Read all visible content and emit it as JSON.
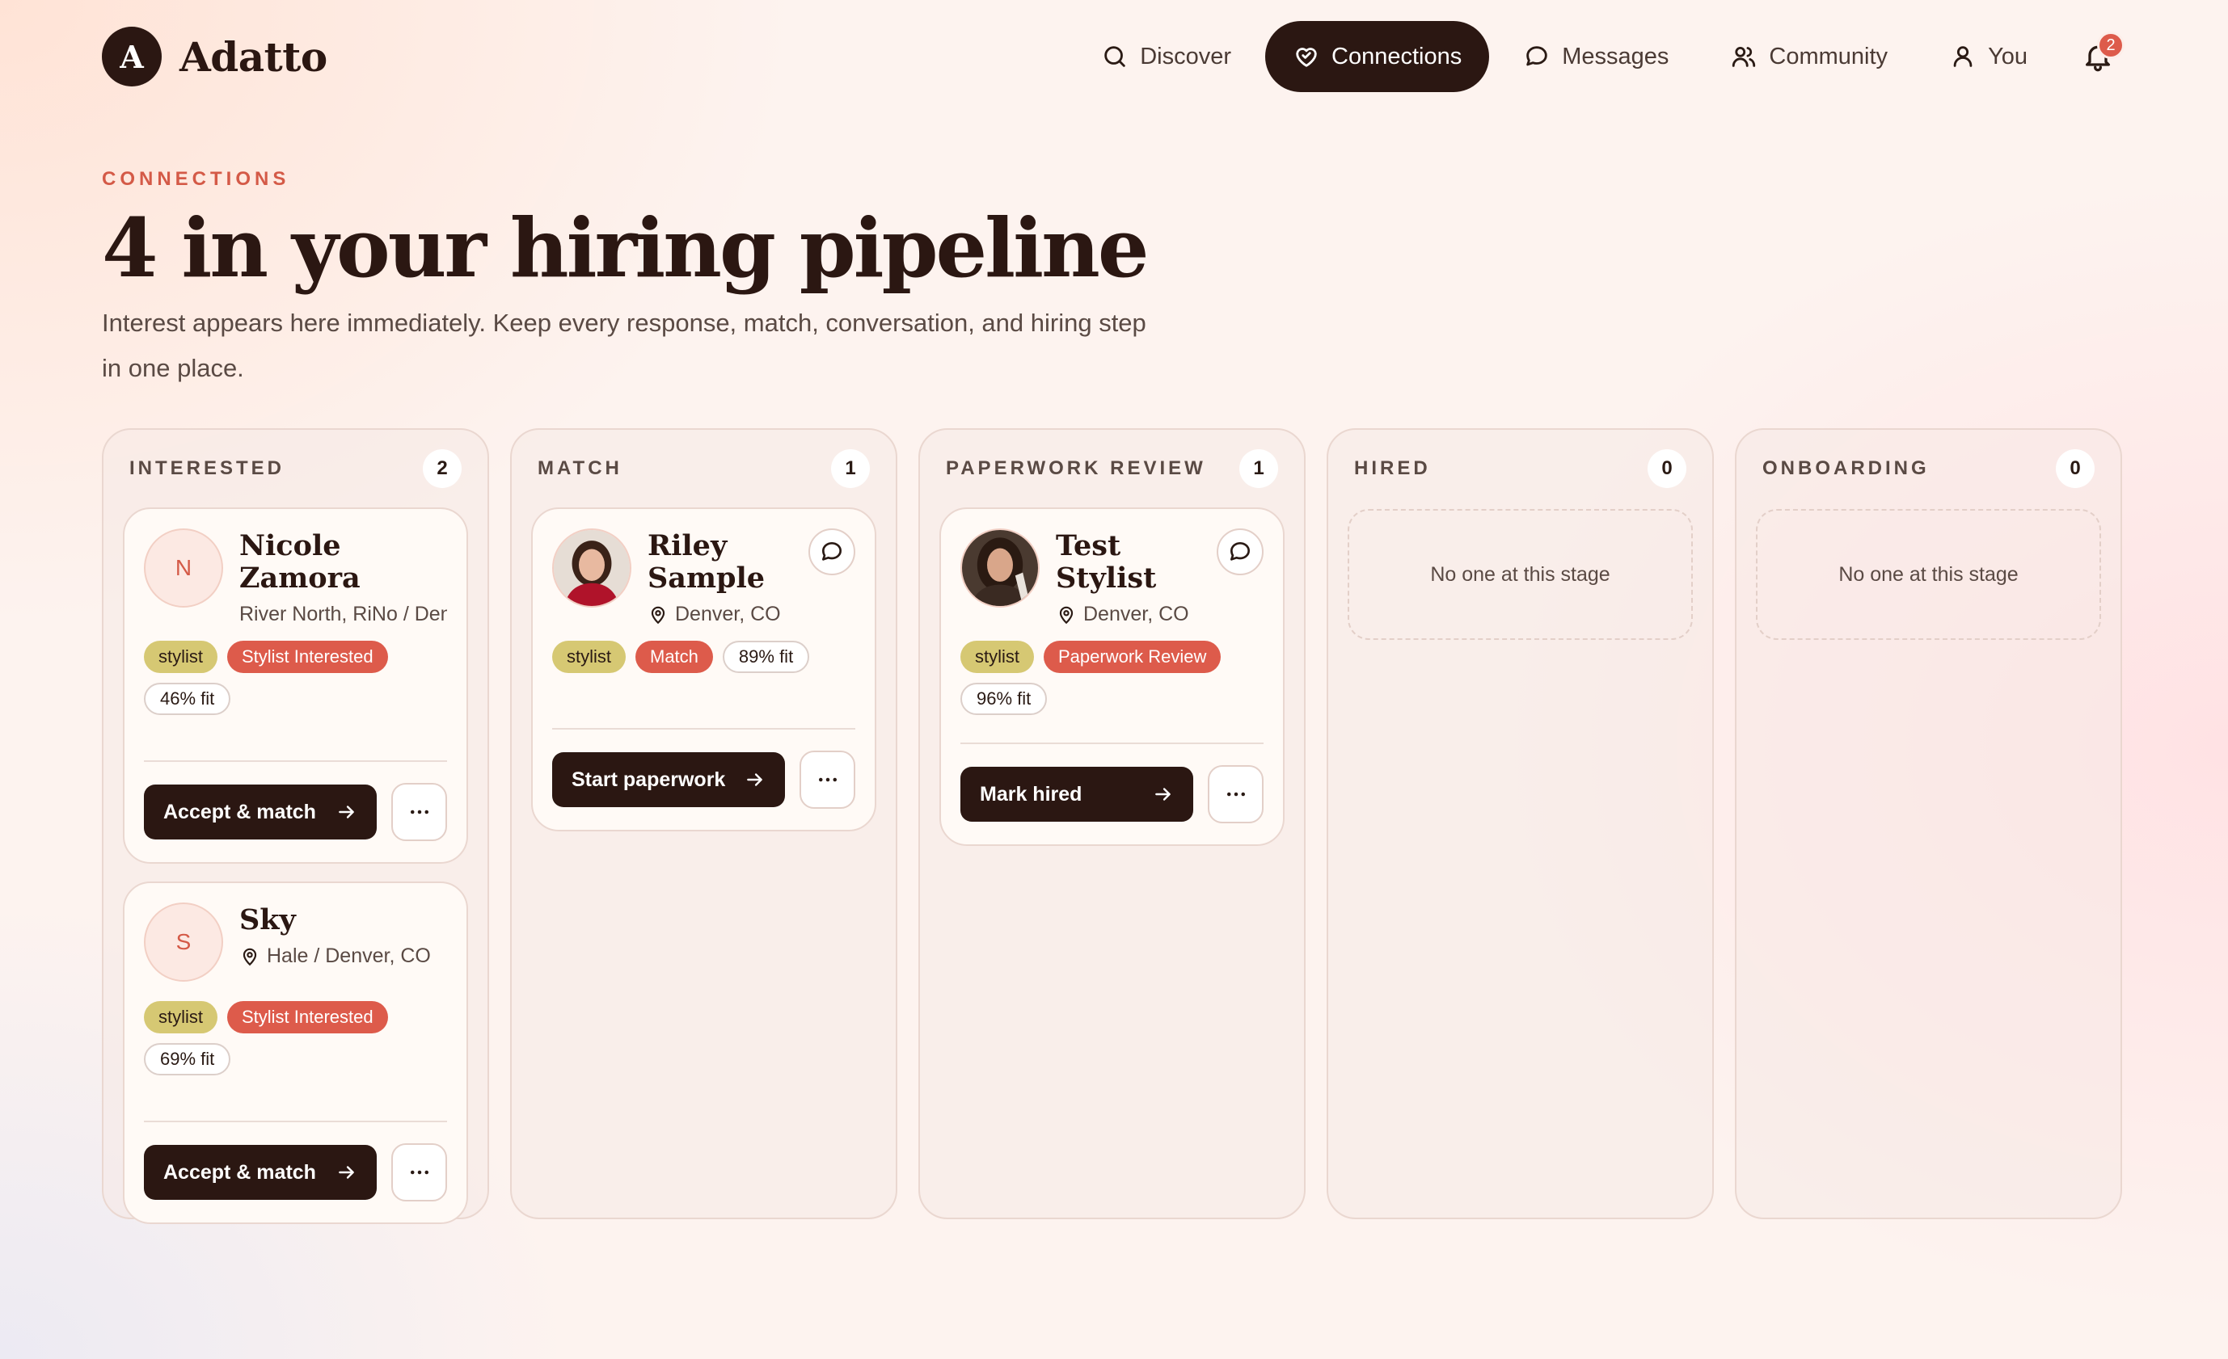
{
  "brand": {
    "mark": "A",
    "name": "Adatto"
  },
  "nav": {
    "items": [
      {
        "label": "Discover",
        "icon": "search-icon"
      },
      {
        "label": "Connections",
        "icon": "heart-handshake-icon",
        "active": true
      },
      {
        "label": "Messages",
        "icon": "chat-bubble-icon"
      },
      {
        "label": "Community",
        "icon": "users-icon"
      },
      {
        "label": "You",
        "icon": "user-icon"
      }
    ],
    "notifications_count": "2"
  },
  "page": {
    "eyebrow": "CONNECTIONS",
    "title": "4 in your hiring pipeline",
    "subtitle": "Interest appears here immediately. Keep every response, match, conversation, and hiring step in one place."
  },
  "columns": [
    {
      "title": "INTERESTED",
      "count": "2",
      "cards": [
        {
          "initial": "N",
          "name": "Nicole Zamora",
          "location": "River North, RiNo / Denver, CO",
          "role": "stylist",
          "stage": "Stylist Interested",
          "fit": "46% fit",
          "action": "Accept & match"
        },
        {
          "initial": "S",
          "name": "Sky",
          "location": "Hale / Denver, CO",
          "role": "stylist",
          "stage": "Stylist Interested",
          "fit": "69% fit",
          "action": "Accept & match"
        }
      ]
    },
    {
      "title": "MATCH",
      "count": "1",
      "cards": [
        {
          "name": "Riley Sample",
          "location": "Denver, CO",
          "role": "stylist",
          "stage": "Match",
          "fit": "89% fit",
          "action": "Start paperwork"
        }
      ]
    },
    {
      "title": "PAPERWORK REVIEW",
      "count": "1",
      "cards": [
        {
          "name": "Test Stylist",
          "location": "Denver, CO",
          "role": "stylist",
          "stage": "Paperwork Review",
          "fit": "96% fit",
          "action": "Mark hired"
        }
      ]
    },
    {
      "title": "HIRED",
      "count": "0",
      "empty": "No one at this stage"
    },
    {
      "title": "ONBOARDING",
      "count": "0",
      "empty": "No one at this stage"
    }
  ],
  "colors": {
    "accent": "#dd5b4b",
    "dark": "#2b1712",
    "role_tag": "#d6c873"
  }
}
